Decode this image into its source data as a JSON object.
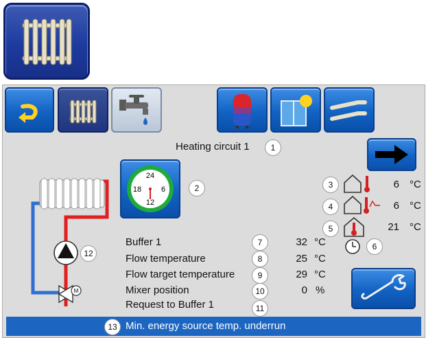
{
  "title": "Heating circuit 1",
  "badges": {
    "title": "1",
    "clock": "2",
    "ext_temp": "3",
    "flow_temp_ind": "4",
    "room_temp": "5",
    "timer": "6",
    "buffer": "7",
    "flow": "8",
    "flow_target": "9",
    "mixer": "10",
    "request": "11",
    "pump": "12",
    "status": "13"
  },
  "clock_numbers": {
    "n24": "24",
    "n6": "6",
    "n12": "12",
    "n18": "18"
  },
  "right_readings": [
    {
      "value": "6",
      "unit": "°C"
    },
    {
      "value": "6",
      "unit": "°C"
    },
    {
      "value": "21",
      "unit": "°C"
    }
  ],
  "rows": [
    {
      "label": "Buffer 1",
      "value": "32",
      "unit": "°C"
    },
    {
      "label": "Flow temperature",
      "value": "25",
      "unit": "°C"
    },
    {
      "label": "Flow target temperature",
      "value": "29",
      "unit": "°C"
    },
    {
      "label": "Mixer position",
      "value": "0",
      "unit": "%"
    },
    {
      "label": "Request to Buffer 1",
      "value": "",
      "unit": ""
    }
  ],
  "status": "Min. energy source temp. underrun",
  "mixer_motor_letter": "M",
  "colors": {
    "accent": "#1c66c2",
    "pipe_red": "#e02020",
    "pipe_blue": "#2f6fd0",
    "clock_ring": "#1faa3c"
  },
  "icons": [
    "radiator-icon",
    "back-arrow-icon",
    "tap-icon",
    "buffer-tank-icon",
    "solar-icon",
    "pipes-icon",
    "arrow-right-icon",
    "wrench-icon",
    "house-thermometer-icon",
    "clock-icon",
    "pump-icon",
    "mixer-valve-icon"
  ]
}
